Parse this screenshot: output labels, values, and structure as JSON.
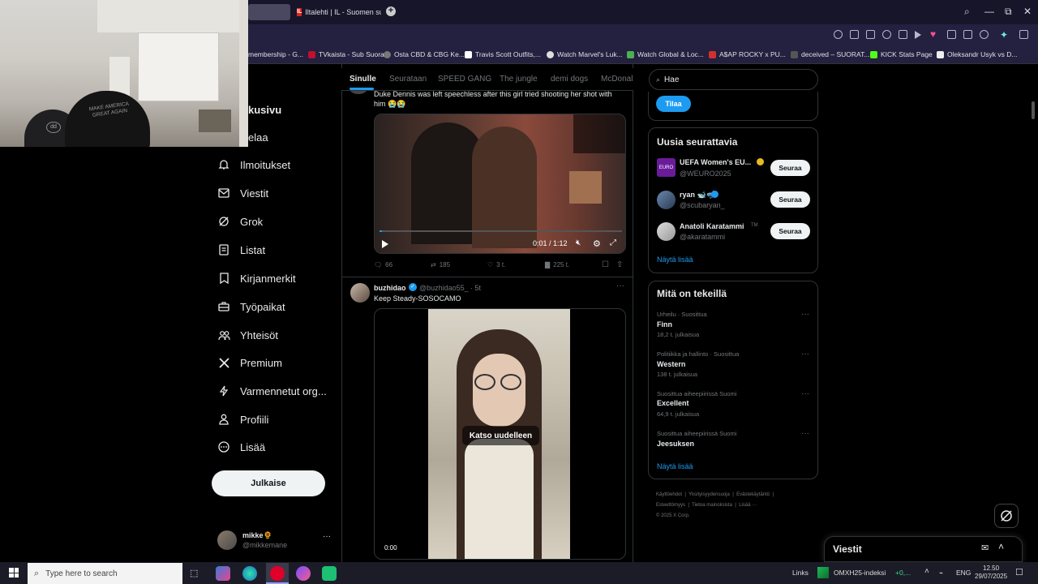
{
  "browser": {
    "tabs": [
      {
        "label": ""
      },
      {
        "label": "Iltalehti | IL - Suomen suosituin"
      }
    ],
    "tab_favicon": "IL",
    "bookmarks": [
      {
        "label": "membership - G..."
      },
      {
        "label": "TVkaista - Sub Suora"
      },
      {
        "label": "Osta CBD & CBG Ke..."
      },
      {
        "label": "Travis Scott Outfits,..."
      },
      {
        "label": "Watch Marvel's Luk..."
      },
      {
        "label": "Watch Global & Loc..."
      },
      {
        "label": "A$AP ROCKY x PU..."
      },
      {
        "label": "deceived – SUORAT..."
      },
      {
        "label": "KICK Stats Page"
      },
      {
        "label": "Oleksandr Usyk vs D..."
      }
    ]
  },
  "nav": {
    "items": [
      {
        "label": "kusivu"
      },
      {
        "label": "elaa"
      },
      {
        "label": "Ilmoitukset"
      },
      {
        "label": "Viestit"
      },
      {
        "label": "Grok"
      },
      {
        "label": "Listat"
      },
      {
        "label": "Kirjanmerkit"
      },
      {
        "label": "Työpaikat"
      },
      {
        "label": "Yhteisöt"
      },
      {
        "label": "Premium"
      },
      {
        "label": "Varmennetut org..."
      },
      {
        "label": "Profiili"
      },
      {
        "label": "Lisää"
      }
    ],
    "post_button": "Julkaise",
    "profile": {
      "name": "mikke🌻",
      "handle": "@mikkemane"
    }
  },
  "webcam": {
    "cap_text_1": "MAKE AMERICA",
    "cap_text_2": "GREAT AGAIN",
    "cap2_text": "dd"
  },
  "feed": {
    "tabs": [
      "Sinulle",
      "Seurataan",
      "SPEED GANG",
      "The jungle",
      "demi dogs",
      "McDonal"
    ],
    "post1": {
      "text_line1": "Duke Dennis was left speechless after this girl tried shooting her shot with",
      "text_line2": "him 😭😭",
      "video_time": "0:01 / 1:12",
      "replies": "66",
      "reposts": "185",
      "likes": "3 t.",
      "views": "225 t."
    },
    "post2": {
      "name": "buzhidao",
      "handle": "@buzhidao55_",
      "time": "· 5t",
      "text": "Keep Steady-SOSOCAMO",
      "replay_label": "Katso uudelleen",
      "video_time": "0:00"
    }
  },
  "sidebar": {
    "search_value": "Hae",
    "subscribe_button": "Tilaa",
    "who_to_follow": {
      "title": "Uusia seurattavia",
      "users": [
        {
          "name": "UEFA Women's EU...",
          "handle": "@WEURO2025",
          "button": "Seuraa",
          "avatar_text": "EURO"
        },
        {
          "name": "ryan 🐋🤿",
          "handle": "@scubaryan_",
          "button": "Seuraa"
        },
        {
          "name": "Anatoli Karatammi",
          "handle": "@akaratammi",
          "button": "Seuraa",
          "suffix": "TM"
        }
      ],
      "show_more": "Näytä lisää"
    },
    "trends": {
      "title": "Mitä on tekeillä",
      "items": [
        {
          "meta": "Urheilu · Suosittua",
          "name": "Finn",
          "count": "18,2 t. julkaisua"
        },
        {
          "meta": "Politiikka ja hallinto · Suosittua",
          "name": "Western",
          "count": "138 t. julkaisua"
        },
        {
          "meta": "Suosittua aiheepiirissä Suomi",
          "name": "Excellent",
          "count": "64,9 t. julkaisua"
        },
        {
          "meta": "Suosittua aiheepiirissä Suomi",
          "name": "Jeesuksen",
          "count": ""
        }
      ],
      "show_more": "Näytä lisää"
    },
    "footer": {
      "line1": [
        "Käyttöehdot",
        "Yksityisyydensuoja",
        "Evästekäytäntö"
      ],
      "line2": [
        "Esteettömyys",
        "Tietoa mainoksista",
        "Lisää ···"
      ],
      "line3": "© 2025 X Corp."
    },
    "messages_label": "Viestit"
  },
  "taskbar": {
    "search_placeholder": "Type here to search",
    "links": "Links",
    "ticker": "OMXH25-indeksi",
    "ticker_change": "+0,...",
    "lang": "ENG",
    "time": "12.50",
    "date": "29/07/2025"
  }
}
